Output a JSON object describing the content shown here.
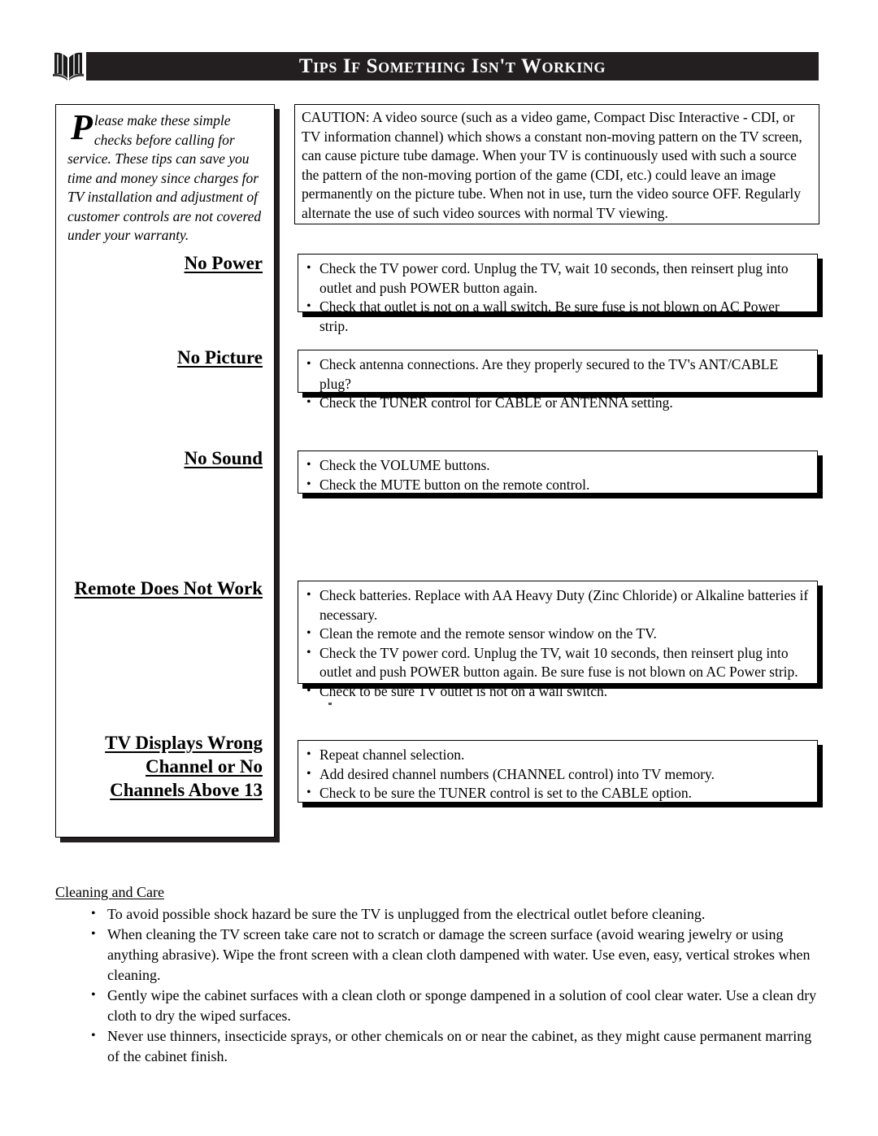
{
  "header": {
    "icon": "open-book-icon",
    "title": "Tips If Something Isn't Working",
    "banner_color": "#231f20"
  },
  "intro": {
    "dropcap": "P",
    "text": "lease make these simple checks before calling for service.  These tips can save you time and money since charges for TV installation and adjustment of customer controls are not covered under your warranty."
  },
  "caution": {
    "text": "CAUTION: A video source (such as a video game, Compact Disc Interactive - CDI, or TV information channel) which shows a constant non-moving pattern on the TV screen, can cause picture tube damage.  When your TV is continuously used with such a source the pattern of the non-moving portion of the game (CDI, etc.) could leave an image permanently on the picture tube.  When not in use, turn the video source OFF.  Regularly alternate the use of such video sources with normal TV viewing."
  },
  "sections": [
    {
      "heading": "No Power",
      "tips": [
        "Check the TV power cord.  Unplug the TV, wait 10 seconds, then reinsert plug into outlet and push POWER button again.",
        "Check that outlet is not on a wall switch. Be sure fuse is not blown on AC Power strip."
      ]
    },
    {
      "heading": "No Picture",
      "tips": [
        "Check antenna connections.  Are they properly secured to the TV's ANT/CABLE plug?",
        "Check the TUNER control for CABLE or ANTENNA setting."
      ]
    },
    {
      "heading": "No Sound",
      "tips": [
        "Check the VOLUME buttons.",
        "Check the MUTE button on the remote control."
      ]
    },
    {
      "heading": "Remote Does Not Work",
      "tips": [
        "Check batteries.  Replace with AA Heavy Duty (Zinc Chloride) or Alkaline batteries if necessary.",
        "Clean the remote and the remote sensor window on the TV.",
        "Check the TV power cord.  Unplug the TV, wait 10 seconds, then reinsert plug into outlet and push POWER button again. Be sure fuse is not blown on AC Power strip.",
        "Check to be sure TV outlet is not on a wall switch."
      ]
    },
    {
      "heading": "TV Displays Wrong Channel or No Channels Above 13",
      "tips": [
        "Repeat channel selection.",
        "Add desired channel numbers (CHANNEL control) into TV memory.",
        "Check to be sure the TUNER control is set to the CABLE option."
      ]
    }
  ],
  "cleaning": {
    "title": "Cleaning and Care",
    "items": [
      "To avoid possible shock hazard be sure the TV is unplugged from the electrical outlet before cleaning.",
      "When cleaning the TV screen take care not to scratch or damage the screen surface (avoid wearing jewelry or using anything abrasive).  Wipe the front screen with a clean cloth dampened with water.  Use even, easy, vertical strokes when cleaning.",
      "Gently wipe the cabinet surfaces with a clean cloth or sponge dampened in a solution of cool clear water.  Use a clean dry cloth to dry the wiped surfaces.",
      "Never use thinners, insecticide sprays, or other chemicals on or near the cabinet, as they might cause permanent marring of the cabinet finish."
    ]
  }
}
